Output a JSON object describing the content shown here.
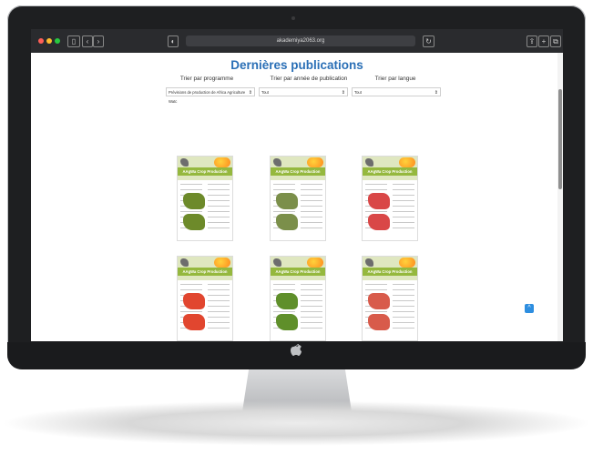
{
  "browser": {
    "url": "akademiya2063.org"
  },
  "page": {
    "title": "Dernières publications",
    "filters": [
      {
        "label": "Trier par programme",
        "selected": "Prévisions de production de Africa Agriculture Watc"
      },
      {
        "label": "Trier par année de publication",
        "selected": "Tout"
      },
      {
        "label": "Trier par langue",
        "selected": "Tout"
      }
    ],
    "cards": [
      {
        "title": "AAgWa Crop Production",
        "map_color": "#6d8a2a"
      },
      {
        "title": "AAgWa Crop Production",
        "map_color": "#7b8f4a"
      },
      {
        "title": "AAgWa Crop Production",
        "map_color": "#d94747"
      },
      {
        "title": "AAgWa Crop Production",
        "map_color": "#e1462f"
      },
      {
        "title": "AAgWa Crop Production",
        "map_color": "#5f8f2a"
      },
      {
        "title": "AAgWa Crop Production",
        "map_color": "#d85b4b"
      }
    ]
  },
  "colors": {
    "title_blue": "#2a6fb6",
    "accent_green": "#95b83e",
    "back_to_top": "#2d8ee0"
  }
}
